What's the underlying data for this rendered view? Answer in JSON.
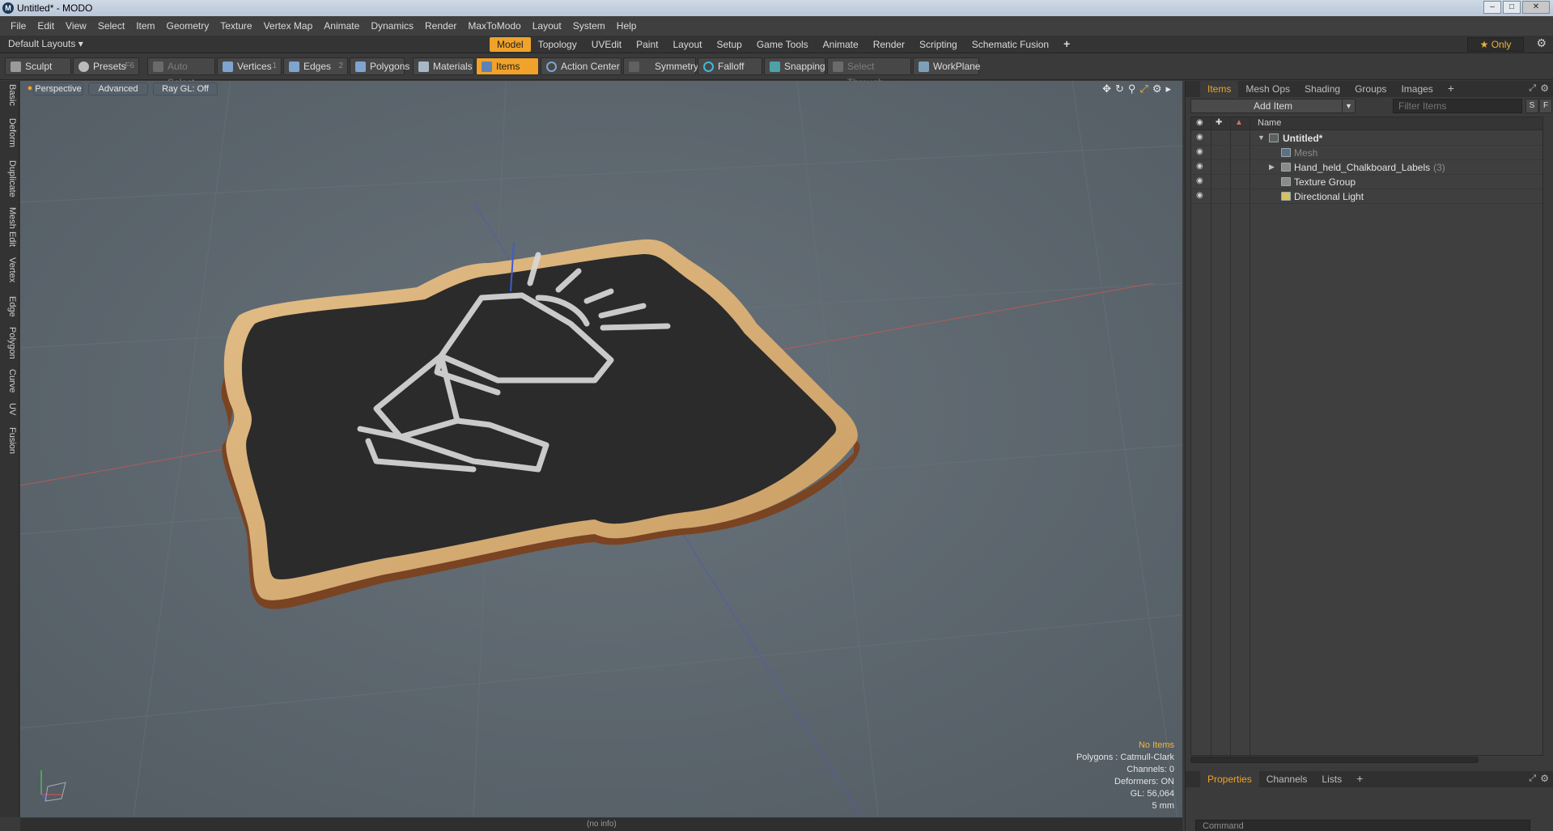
{
  "window": {
    "title": "Untitled* - MODO",
    "icon": "modo-logo-icon",
    "buttons": [
      "minimize",
      "maximize",
      "close"
    ]
  },
  "menubar": {
    "items": [
      "File",
      "Edit",
      "View",
      "Select",
      "Item",
      "Geometry",
      "Texture",
      "Vertex Map",
      "Animate",
      "Dynamics",
      "Render",
      "MaxToModo",
      "Layout",
      "System",
      "Help"
    ]
  },
  "layoutbar": {
    "layouts_label": "Default Layouts ▾",
    "tabs": [
      "Model",
      "Topology",
      "UVEdit",
      "Paint",
      "Layout",
      "Setup",
      "Game Tools",
      "Animate",
      "Render",
      "Scripting",
      "Schematic Fusion"
    ],
    "active_tab": "Model",
    "add_tab": "+",
    "only_label": "★ Only"
  },
  "toolbar": {
    "sculpt": "Sculpt",
    "presets": "Presets",
    "presets_key": "F6",
    "auto_select": "Auto Select",
    "vertices": "Vertices",
    "vertices_key": "1",
    "edges": "Edges",
    "edges_key": "2",
    "polygons": "Polygons",
    "materials": "Materials",
    "items": "Items",
    "action_center": "Action Center",
    "symmetry": "Symmetry",
    "falloff": "Falloff",
    "snapping": "Snapping",
    "select_through": "Select Through",
    "workplane": "WorkPlane"
  },
  "left_tabs": [
    "Basic",
    "Deform",
    "Duplicate",
    "Mesh Edit",
    "Vertex",
    "Edge",
    "Polygon",
    "Curve",
    "UV",
    "Fusion"
  ],
  "viewport": {
    "view": "Perspective",
    "shading": "Advanced",
    "raygl": "Ray GL: Off",
    "status": {
      "selection": "No Items",
      "polygons": "Polygons : Catmull-Clark",
      "channels": "Channels: 0",
      "deformers": "Deformers: ON",
      "gl": "GL: 56,064",
      "units": "5 mm"
    }
  },
  "bottom": {
    "info": "(no info)"
  },
  "rightpanel": {
    "tabs": [
      "Items",
      "Mesh Ops",
      "Shading",
      "Groups",
      "Images"
    ],
    "active_tab": "Items",
    "add_tab": "+",
    "add_item": "Add Item",
    "filter_placeholder": "Filter Items",
    "s_button": "S",
    "f_button": "F",
    "column_name": "Name",
    "tree": [
      {
        "label": "Untitled*",
        "level": 0,
        "bold": true
      },
      {
        "label": "Mesh",
        "level": 1,
        "dim": true
      },
      {
        "label": "Hand_held_Chalkboard_Labels",
        "count": "(3)",
        "level": 1
      },
      {
        "label": "Texture Group",
        "level": 1
      },
      {
        "label": "Directional Light",
        "level": 1
      }
    ],
    "bottom_tabs": [
      "Properties",
      "Channels",
      "Lists"
    ],
    "bottom_active": "Properties",
    "command_placeholder": "Command"
  },
  "colors": {
    "accent": "#f0a22a",
    "viewport_bg": "#5b646b",
    "chalkboard": "#2b2b2b",
    "frame_wood": "#d6ae78",
    "frame_edge": "#8a4f28"
  }
}
